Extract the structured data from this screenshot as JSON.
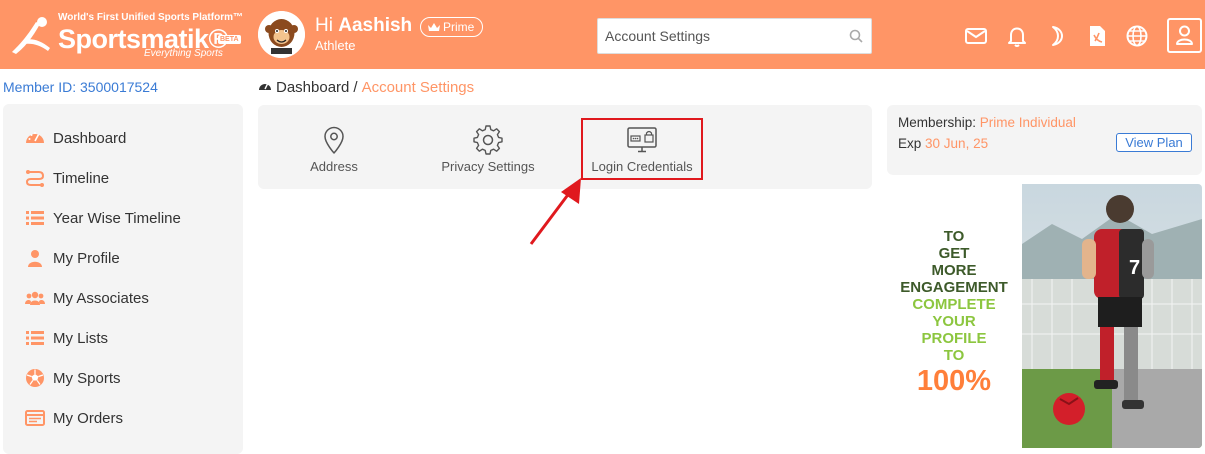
{
  "header": {
    "tagline": "World's First Unified Sports Platform™",
    "brand": "Sportsmatik®",
    "beta": "BETA",
    "sub": "Everything Sports",
    "greeting_prefix": "Hi",
    "user_name": "Aashish",
    "badge": "Prime",
    "role": "Athlete",
    "search_value": "Account Settings",
    "icons": [
      "mail-icon",
      "bell-icon",
      "moon-icon",
      "document-icon",
      "globe-icon",
      "user-icon"
    ],
    "colors": {
      "header_bg": "#ff9566",
      "accent": "#ff9566",
      "link": "#3a7bd5"
    }
  },
  "member": {
    "label": "Member ID: 3500017524"
  },
  "breadcrumb": {
    "home": "Dashboard",
    "separator": "/",
    "current": "Account Settings"
  },
  "sidebar": {
    "items": [
      {
        "label": "Dashboard",
        "icon": "dashboard-icon"
      },
      {
        "label": "Timeline",
        "icon": "timeline-icon"
      },
      {
        "label": "Year Wise Timeline",
        "icon": "list-icon"
      },
      {
        "label": "My Profile",
        "icon": "person-icon"
      },
      {
        "label": "My Associates",
        "icon": "group-icon"
      },
      {
        "label": "My Lists",
        "icon": "list-icon"
      },
      {
        "label": "My Sports",
        "icon": "ball-icon"
      },
      {
        "label": "My Orders",
        "icon": "orders-icon"
      }
    ]
  },
  "settings": {
    "options": [
      {
        "label": "Address",
        "icon": "location-pin-icon"
      },
      {
        "label": "Privacy Settings",
        "icon": "gear-icon"
      },
      {
        "label": "Login Credentials",
        "icon": "monitor-lock-icon"
      }
    ],
    "highlighted": "Login Credentials"
  },
  "membership": {
    "label": "Membership:",
    "plan": "Prime Individual",
    "exp_label": "Exp",
    "exp_date": "30 Jun, 25",
    "button": "View Plan"
  },
  "promo": {
    "lines": [
      "TO",
      "GET",
      "MORE",
      "ENGAGEMENT",
      "COMPLETE",
      "YOUR",
      "PROFILE",
      "TO",
      "100%"
    ]
  }
}
